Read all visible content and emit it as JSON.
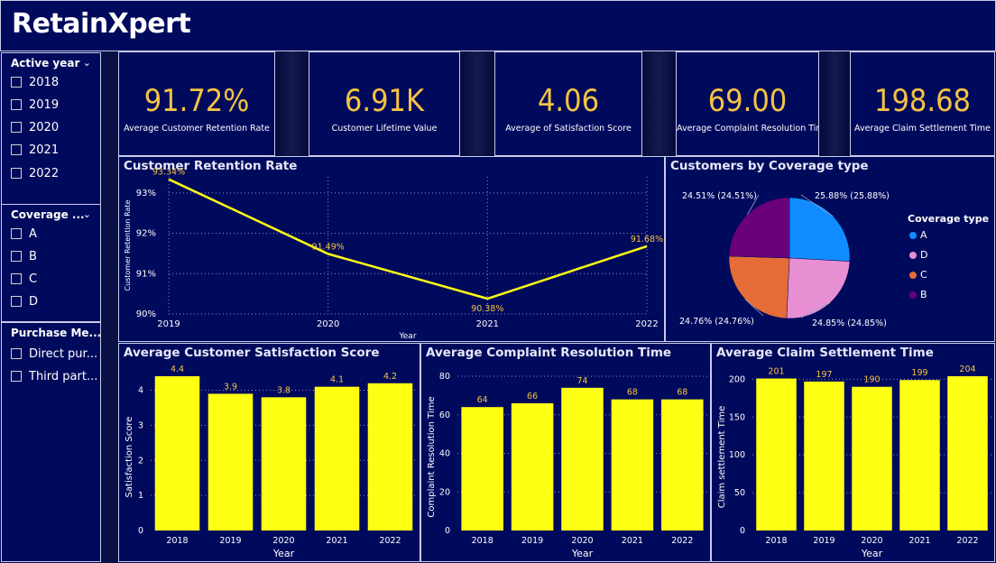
{
  "app": {
    "title": "RetainXpert"
  },
  "slicers": {
    "year": {
      "title": "Active year",
      "items": [
        "2018",
        "2019",
        "2020",
        "2021",
        "2022"
      ]
    },
    "coverage": {
      "title": "Coverage ...",
      "items": [
        "A",
        "B",
        "C",
        "D"
      ]
    },
    "purchase": {
      "title": "Purchase Me...",
      "items": [
        "Direct pur...",
        "Third part..."
      ]
    }
  },
  "kpis": [
    {
      "value": "91.72%",
      "label": "Average Customer Retention Rate"
    },
    {
      "value": "6.91K",
      "label": "Customer Lifetime Value"
    },
    {
      "value": "4.06",
      "label": "Average of Satisfaction Score"
    },
    {
      "value": "69.00",
      "label": "Average Complaint Resolution Time"
    },
    {
      "value": "198.68",
      "label": "Average Claim Settlement Time"
    }
  ],
  "colors": {
    "accent": "#f5c343",
    "bar": "#ffff14",
    "line": "#ffff14",
    "background": "#000a5c"
  },
  "chart_data": [
    {
      "type": "line",
      "title": "Customer Retention Rate",
      "xlabel": "Year",
      "ylabel": "Customer Retention Rate",
      "x": [
        "2019",
        "2020",
        "2021",
        "2022"
      ],
      "values": [
        93.34,
        91.49,
        90.38,
        91.68
      ],
      "data_labels": [
        "93.34%",
        "91.49%",
        "90.38%",
        "91.68%"
      ],
      "yticks": [
        "90%",
        "91%",
        "92%",
        "93%"
      ],
      "ylim": [
        90,
        93.4
      ],
      "grid": true
    },
    {
      "type": "pie",
      "title": "Customers by Coverage type",
      "legend_title": "Coverage type",
      "legend_position": "right",
      "slices": [
        {
          "name": "A",
          "value": 25.88,
          "label": "25.88% (25.88%)",
          "color": "#118dff"
        },
        {
          "name": "D",
          "value": 24.85,
          "label": "24.85% (24.85%)",
          "color": "#e88fd3"
        },
        {
          "name": "C",
          "value": 24.76,
          "label": "24.76% (24.76%)",
          "color": "#e66c37"
        },
        {
          "name": "B",
          "value": 24.51,
          "label": "24.51% (24.51%)",
          "color": "#6b007b"
        }
      ]
    },
    {
      "type": "bar",
      "title": "Average Customer Satisfaction Score",
      "xlabel": "Year",
      "ylabel": "Satisfaction Score",
      "categories": [
        "2018",
        "2019",
        "2020",
        "2021",
        "2022"
      ],
      "values": [
        4.4,
        3.9,
        3.8,
        4.1,
        4.2
      ],
      "data_labels": [
        "4.4",
        "3.9",
        "3.8",
        "4.1",
        "4.2"
      ],
      "yticks": [
        "0",
        "1",
        "2",
        "3",
        "4"
      ],
      "ylim": [
        0,
        4.4
      ]
    },
    {
      "type": "bar",
      "title": "Average Complaint Resolution Time",
      "xlabel": "Year",
      "ylabel": "Complaint Resolution Time",
      "categories": [
        "2018",
        "2019",
        "2020",
        "2021",
        "2022"
      ],
      "values": [
        64,
        66,
        74,
        68,
        68
      ],
      "data_labels": [
        "64",
        "66",
        "74",
        "68",
        "68"
      ],
      "yticks": [
        "0",
        "20",
        "40",
        "60",
        "80"
      ],
      "ylim": [
        0,
        80
      ]
    },
    {
      "type": "bar",
      "title": "Average Claim Settlement Time",
      "xlabel": "Year",
      "ylabel": "Claim settlement Time",
      "categories": [
        "2018",
        "2019",
        "2020",
        "2021",
        "2022"
      ],
      "values": [
        201,
        197,
        190,
        199,
        204
      ],
      "data_labels": [
        "201",
        "197",
        "190",
        "199",
        "204"
      ],
      "yticks": [
        "0",
        "50",
        "100",
        "150",
        "200"
      ],
      "ylim": [
        0,
        204
      ]
    }
  ]
}
